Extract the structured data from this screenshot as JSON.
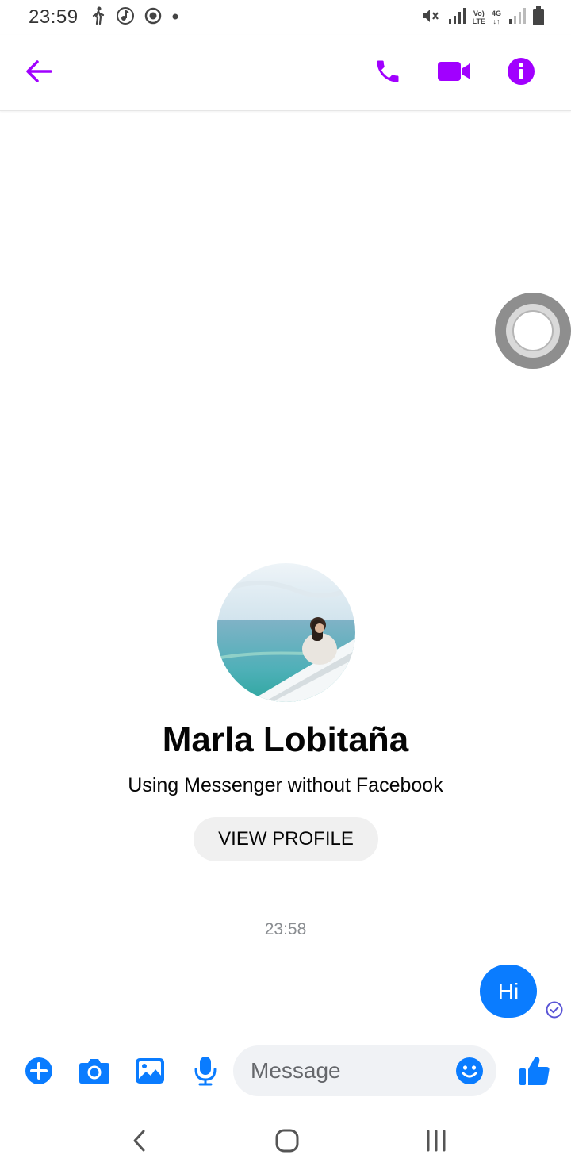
{
  "status_bar": {
    "time": "23:59",
    "network_lines": [
      "Vo)",
      "LTE"
    ],
    "network_type": "4G",
    "icons": [
      "walking-icon",
      "music-icon",
      "record-icon",
      "dot-icon",
      "mute-icon",
      "signal-icon",
      "volte-icon",
      "4g-icon",
      "signal-icon",
      "battery-icon"
    ]
  },
  "app_bar": {
    "accent_color": "#a100ff",
    "icons": [
      "back-arrow-icon",
      "phone-icon",
      "video-camera-icon",
      "info-icon"
    ]
  },
  "contact": {
    "name": "Marla Lobitaña",
    "subtitle": "Using Messenger without Facebook",
    "view_profile_label": "VIEW PROFILE"
  },
  "conversation": {
    "timestamp": "23:58",
    "messages": [
      {
        "direction": "outgoing",
        "text": "Hi",
        "color": "#0a7cff"
      }
    ]
  },
  "composer": {
    "placeholder": "Message",
    "icon_color": "#0a7cff",
    "icons": [
      "plus-icon",
      "camera-icon",
      "gallery-icon",
      "microphone-icon",
      "emoji-icon",
      "thumbs-up-icon"
    ]
  },
  "nav_bar": {
    "icons": [
      "back-nav-icon",
      "home-nav-icon",
      "recents-nav-icon"
    ]
  }
}
